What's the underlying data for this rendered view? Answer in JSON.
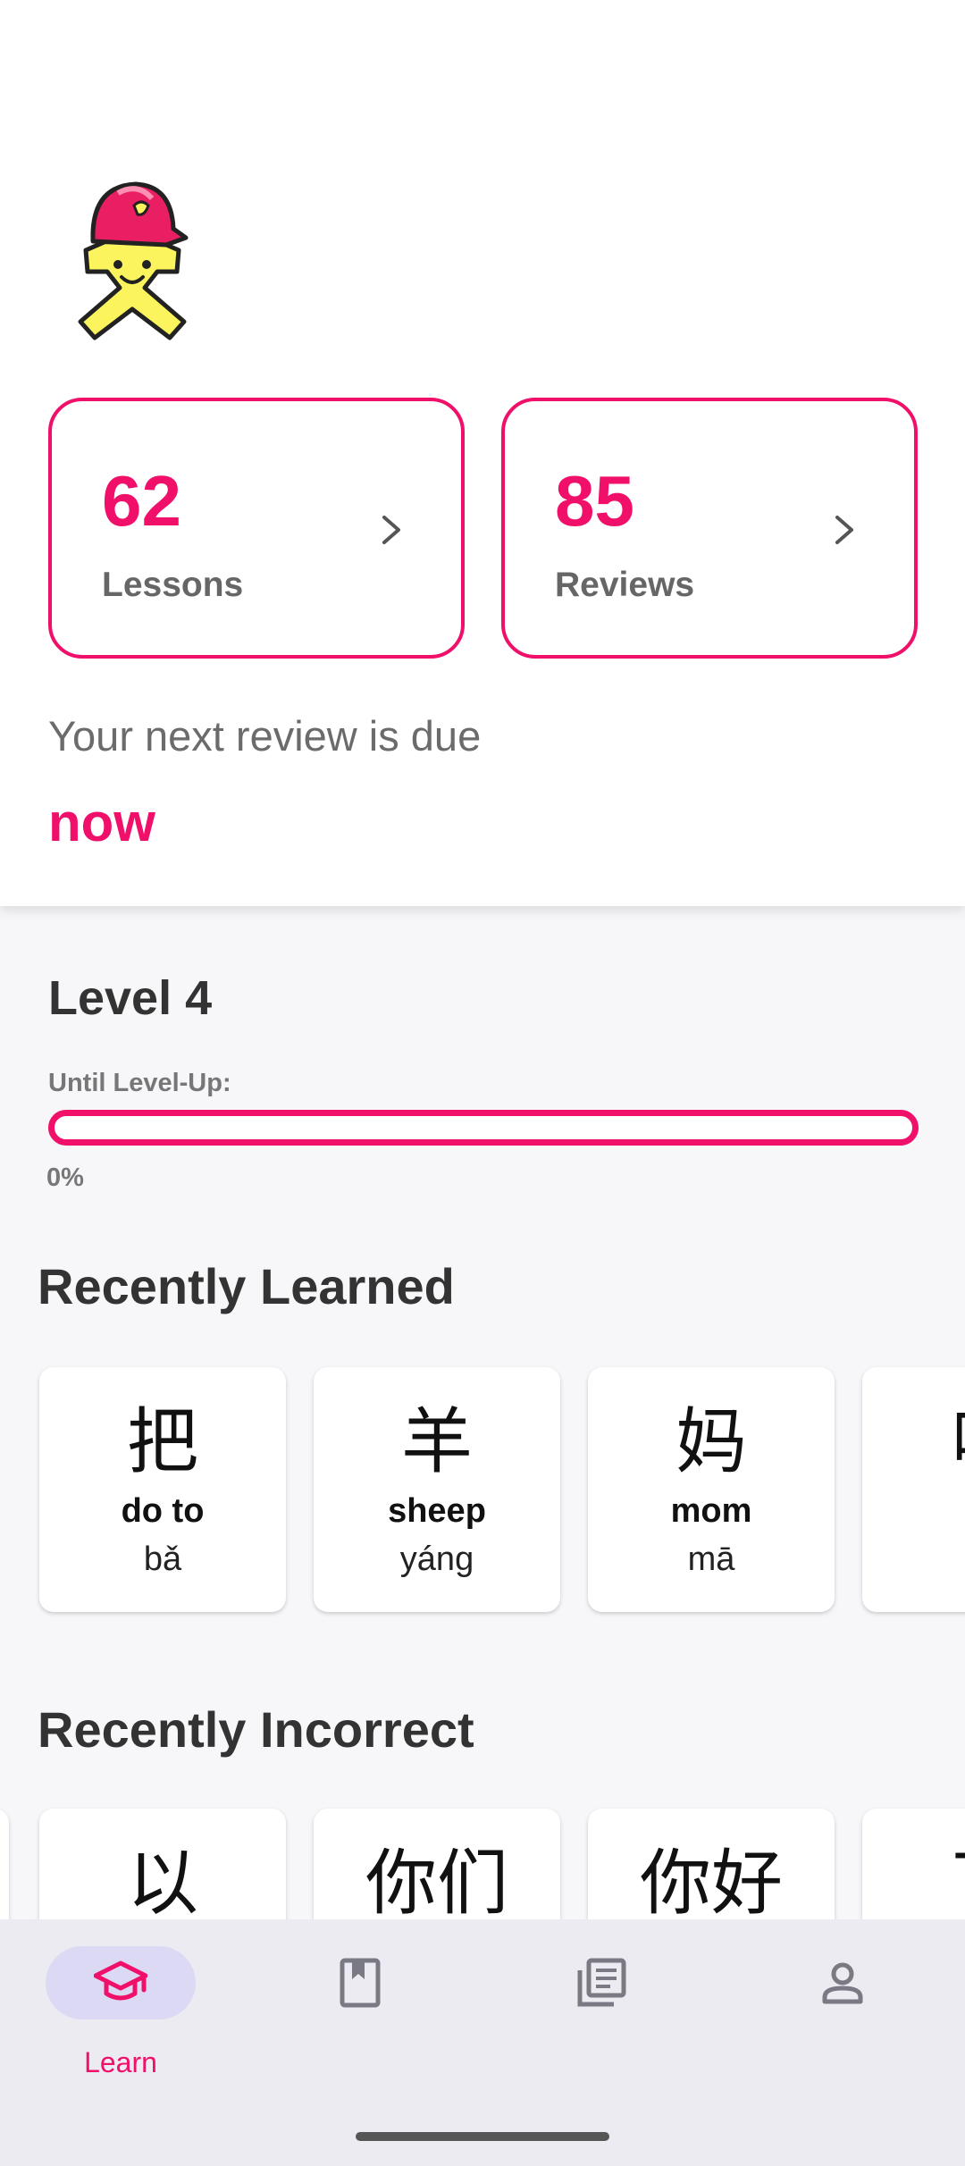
{
  "header": {
    "mascot_icon": "mascot-logo-icon",
    "lessons": {
      "count": "62",
      "label": "Lessons"
    },
    "reviews": {
      "count": "85",
      "label": "Reviews"
    },
    "next_review_text": "Your next review is due",
    "next_review_when": "now"
  },
  "level": {
    "title": "Level 4",
    "until_label": "Until Level-Up:",
    "progress_percent": 0,
    "progress_text": "0%"
  },
  "recently_learned": {
    "title": "Recently Learned",
    "items": [
      {
        "hanzi": "把",
        "meaning": "do to",
        "pinyin": "bǎ"
      },
      {
        "hanzi": "羊",
        "meaning": "sheep",
        "pinyin": "yáng"
      },
      {
        "hanzi": "妈",
        "meaning": "mom",
        "pinyin": "mā"
      },
      {
        "hanzi": "吗",
        "meaning": "",
        "pinyin": ""
      }
    ]
  },
  "recently_incorrect": {
    "title": "Recently Incorrect",
    "items": [
      {
        "hanzi": "以"
      },
      {
        "hanzi": "你们"
      },
      {
        "hanzi": "你好"
      },
      {
        "hanzi": "下"
      }
    ]
  },
  "bottom_nav": {
    "items": [
      {
        "label": "Learn",
        "icon": "graduation-cap-icon",
        "active": true
      },
      {
        "label": "",
        "icon": "bookmark-book-icon",
        "active": false
      },
      {
        "label": "",
        "icon": "article-list-icon",
        "active": false
      },
      {
        "label": "",
        "icon": "person-icon",
        "active": false
      }
    ]
  },
  "colors": {
    "accent": "#f0106a",
    "background": "#f7f7fa",
    "nav_background": "#ecebf2",
    "nav_active_pill": "#dcd9f4"
  }
}
